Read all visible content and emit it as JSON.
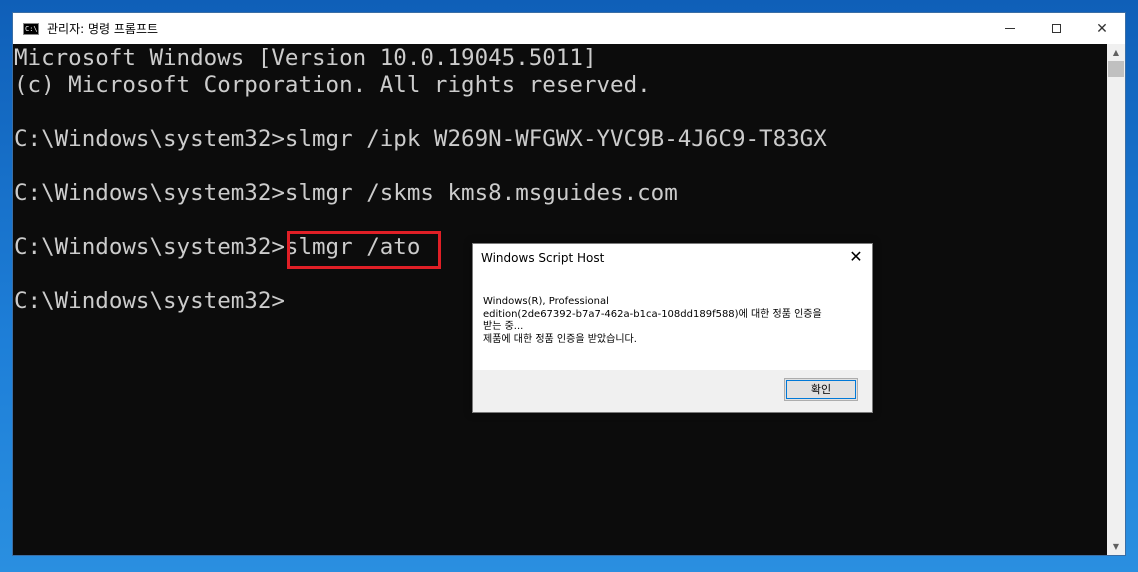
{
  "window": {
    "title": "관리자: 명령 프롬프트",
    "icon_text": "C:\\",
    "caption_close": "✕"
  },
  "console": {
    "lines": [
      "Microsoft Windows [Version 10.0.19045.5011]",
      "(c) Microsoft Corporation. All rights reserved.",
      "",
      "C:\\Windows\\system32>slmgr /ipk W269N-WFGWX-YVC9B-4J6C9-T83GX",
      "",
      "C:\\Windows\\system32>slmgr /skms kms8.msguides.com",
      "",
      "C:\\Windows\\system32>slmgr /ato",
      "",
      "C:\\Windows\\system32>"
    ]
  },
  "dialog": {
    "title": "Windows Script Host",
    "close_label": "✕",
    "message_lines": [
      "Windows(R), Professional",
      "edition(2de67392-b7a7-462a-b1ca-108dd189f588)에 대한 정품 인증을",
      "받는 중...",
      "제품에 대한 정품 인증을 받았습니다."
    ],
    "ok_label": "확인"
  },
  "colors": {
    "console_bg": "#0c0c0c",
    "console_text": "#cccccc",
    "highlight": "#e01f26",
    "accent": "#0078d7"
  }
}
